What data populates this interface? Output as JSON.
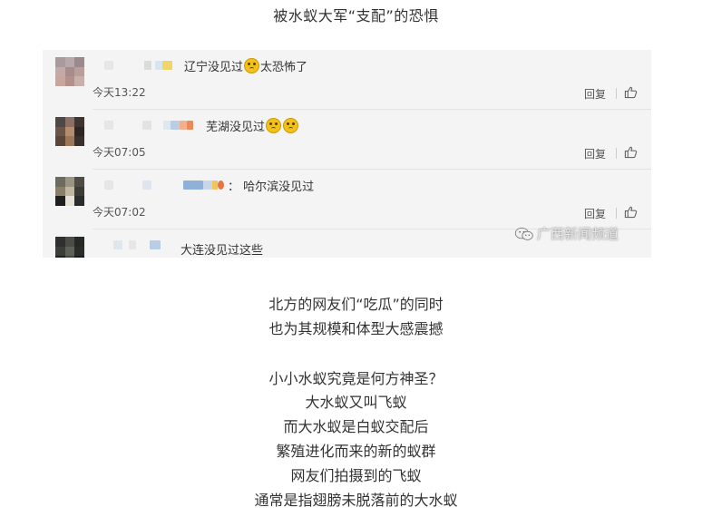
{
  "header": {
    "title": "被水蚁大军“支配”的恐惧"
  },
  "comments": [
    {
      "text": "辽宁没见过",
      "suffix": "太恐怖了",
      "time": "今天13:22",
      "reply": "回复"
    },
    {
      "text": "芜湖没见过",
      "suffix": "",
      "time": "今天07:05",
      "reply": "回复"
    },
    {
      "text": "：  哈尔滨没见过",
      "suffix": "",
      "time": "今天07:02",
      "reply": "回复"
    },
    {
      "text": "大连没见过这些"
    }
  ],
  "watermark": {
    "label": "广西新闻频道"
  },
  "paragraphs": [
    "北方的网友们“吃瓜”的同时",
    "也为其规模和体型大感震撼",
    "小小水蚁究竟是何方神圣？",
    "大水蚁又叫飞蚁",
    "而大水蚁是白蚁交配后",
    "繁殖进化而来的新的蚁群",
    "网友们拍摄到的飞蚁",
    "通常是指翅膀未脱落前的大水蚁"
  ],
  "colors": {
    "panel_bg": "#f4f4f4",
    "text": "#333333",
    "meta": "#555555"
  },
  "icons": [
    "emoji-icon",
    "thumbs-up-icon",
    "wechat-icon"
  ]
}
